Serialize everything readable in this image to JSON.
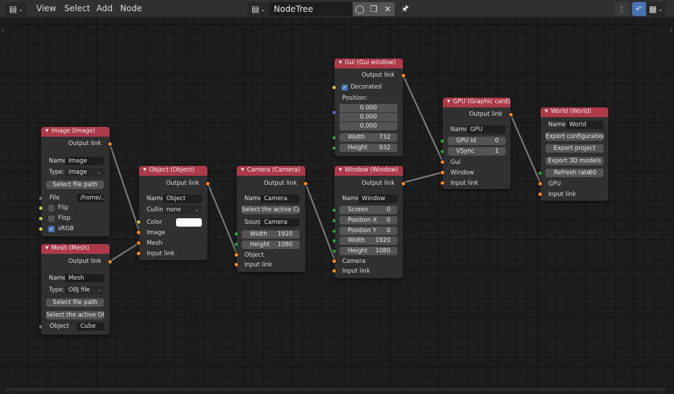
{
  "header": {
    "editor_type_icon": "node-editor-icon",
    "menus": [
      "View",
      "Select",
      "Add",
      "Node"
    ],
    "tree_type_icon": "node-tree-icon",
    "tree_name": "NodeTree",
    "fake_user_icon": "shield-icon",
    "duplicate_icon": "duplicate-icon",
    "unlink_icon": "close-icon",
    "pin_icon": "pin-icon",
    "parent_icon": "arrow-up-icon",
    "snap_icon": "magnet-icon",
    "snap_mode_icon": "grid-snap-icon"
  },
  "nodes": {
    "image": {
      "title": "Image (Image)",
      "output": "Output link",
      "name_label": "Name:",
      "name_value": "Image",
      "type_label": "Type:",
      "type_value": "image",
      "select_file_btn": "Select file path",
      "file_label": "File",
      "file_value": "/home/...",
      "flip_label": "Flip",
      "flip_checked": false,
      "flop_label": "Flop",
      "flop_checked": false,
      "srgb_label": "sRGB",
      "srgb_checked": true
    },
    "mesh": {
      "title": "Mesh (Mesh)",
      "output": "Output link",
      "name_label": "Name:",
      "name_value": "Mesh",
      "type_label": "Type:",
      "type_value": "OBJ file",
      "select_file_btn": "Select file path",
      "select_active_btn": "Select the active Obj...",
      "object_label": "Object",
      "object_value": "Cube"
    },
    "object": {
      "title": "Object (Object)",
      "output": "Output link",
      "name_label": "Name:",
      "name_value": "Object",
      "cullin_label": "Cullin",
      "cullin_value": "none",
      "color_label": "Color",
      "color_value": "#ffffff",
      "inputs": [
        "Image",
        "Mesh",
        "Input link"
      ]
    },
    "camera": {
      "title": "Camera (Camera)",
      "output": "Output link",
      "name_label": "Name:",
      "name_value": "Camera",
      "select_active_btn": "Select the active Ca...",
      "source_label": "Sourc",
      "source_value": "Camera",
      "width_label": "Width",
      "width_value": "1920",
      "height_label": "Height",
      "height_value": "1080",
      "inputs": [
        "Object",
        "Input link"
      ]
    },
    "gui": {
      "title": "Gui (Gui window)",
      "output": "Output link",
      "decorated_label": "Decorated",
      "decorated_checked": true,
      "position_label": "Position:",
      "position": [
        "0.000",
        "0.000",
        "0.000"
      ],
      "width_label": "Width",
      "width_value": "732",
      "height_label": "Height",
      "height_value": "932"
    },
    "window": {
      "title": "Window (Window)",
      "output": "Output link",
      "name_label": "Name:",
      "name_value": "Window",
      "fields": [
        {
          "label": "Screen",
          "value": "0"
        },
        {
          "label": "Position X",
          "value": "0"
        },
        {
          "label": "Position Y",
          "value": "0"
        },
        {
          "label": "Width",
          "value": "1920"
        },
        {
          "label": "Height",
          "value": "1080"
        }
      ],
      "inputs": [
        "Camera",
        "Input link"
      ]
    },
    "gpu": {
      "title": "GPU (Graphic card)",
      "output": "Output link",
      "name_label": "Name:",
      "name_value": "GPU",
      "fields": [
        {
          "label": "GPU Id",
          "value": "0"
        },
        {
          "label": "VSync",
          "value": "1"
        }
      ],
      "inputs": [
        "Gui",
        "Window",
        "Input link"
      ]
    },
    "world": {
      "title": "World (World)",
      "name_label": "Name:",
      "name_value": "World",
      "buttons": [
        "Export configuration",
        "Export project",
        "Export 3D models"
      ],
      "refresh_label": "Refresh rate",
      "refresh_value": "60",
      "inputs": [
        "GPU",
        "Input link"
      ]
    }
  },
  "colors": {
    "node_header": "#ad3a48",
    "socket_shader": "#ff8c1a",
    "socket_color": "#c8c83c",
    "socket_value": "#2e9a3a",
    "socket_vector": "#6464c8",
    "socket_string": "#6c6c6c",
    "checkbox_on": "#4772b3"
  }
}
